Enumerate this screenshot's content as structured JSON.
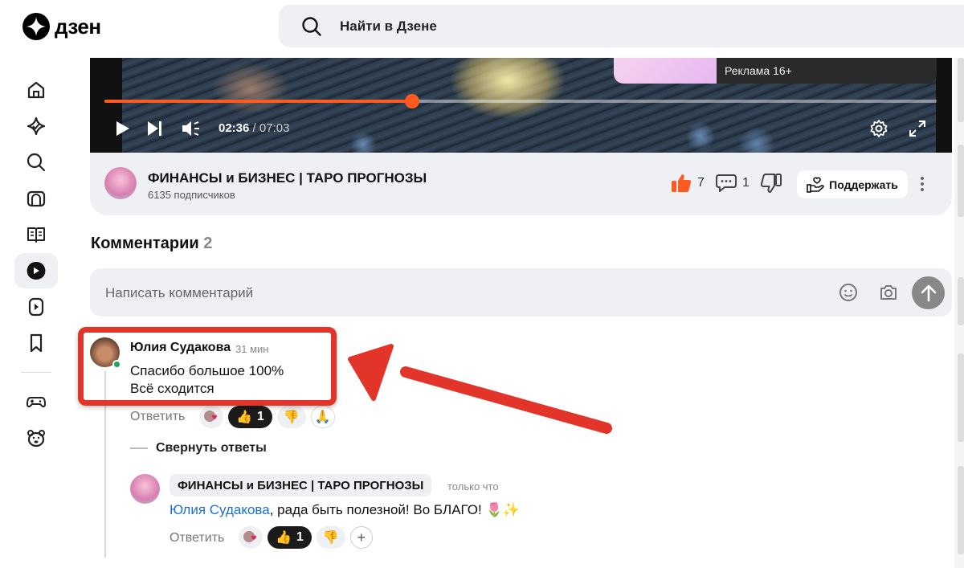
{
  "header": {
    "logo_text": "дзен",
    "search_placeholder": "Найти в Дзене"
  },
  "sidebar": {
    "items": [
      {
        "icon": "home-icon"
      },
      {
        "icon": "subscriptions-icon"
      },
      {
        "icon": "search-icon"
      },
      {
        "icon": "news-icon"
      },
      {
        "icon": "articles-icon"
      },
      {
        "icon": "video-icon",
        "active": true
      },
      {
        "icon": "shorts-icon"
      },
      {
        "icon": "bookmark-icon"
      },
      {
        "icon": "games-icon"
      },
      {
        "icon": "kids-icon"
      }
    ]
  },
  "video": {
    "ad_label": "Реклама 16+",
    "time_current": "02:36",
    "time_total": "07:03",
    "progress": 0.37
  },
  "channel": {
    "name": "ФИНАНСЫ и БИЗНЕС | ТАРО ПРОГНОЗЫ",
    "subscribers": "6135 подписчиков",
    "likes": "7",
    "comments": "1",
    "support_label": "Поддержать"
  },
  "comments": {
    "title": "Комментарии",
    "count": "2",
    "input_placeholder": "Написать комментарий",
    "collapse_label": "Свернуть ответы",
    "items": [
      {
        "author": "Юлия Судакова",
        "time": "31 мин",
        "line1": "Спасибо большое 100%",
        "line2": "Всё сходится",
        "reply_label": "Ответить",
        "reaction_count": "1"
      }
    ],
    "reply": {
      "author": "ФИНАНСЫ и БИЗНЕС | ТАРО ПРОГНОЗЫ",
      "time": "только что",
      "mention": "Юлия Судакова",
      "text": ", рада быть полезной! Во БЛАГО! 🌷✨",
      "reply_label": "Ответить",
      "reaction_count": "1",
      "plus": "+"
    }
  },
  "colors": {
    "accent": "#ff5a1f",
    "highlight": "#e3342a",
    "mention": "#1a6fd6",
    "surface": "#eff0f3"
  }
}
